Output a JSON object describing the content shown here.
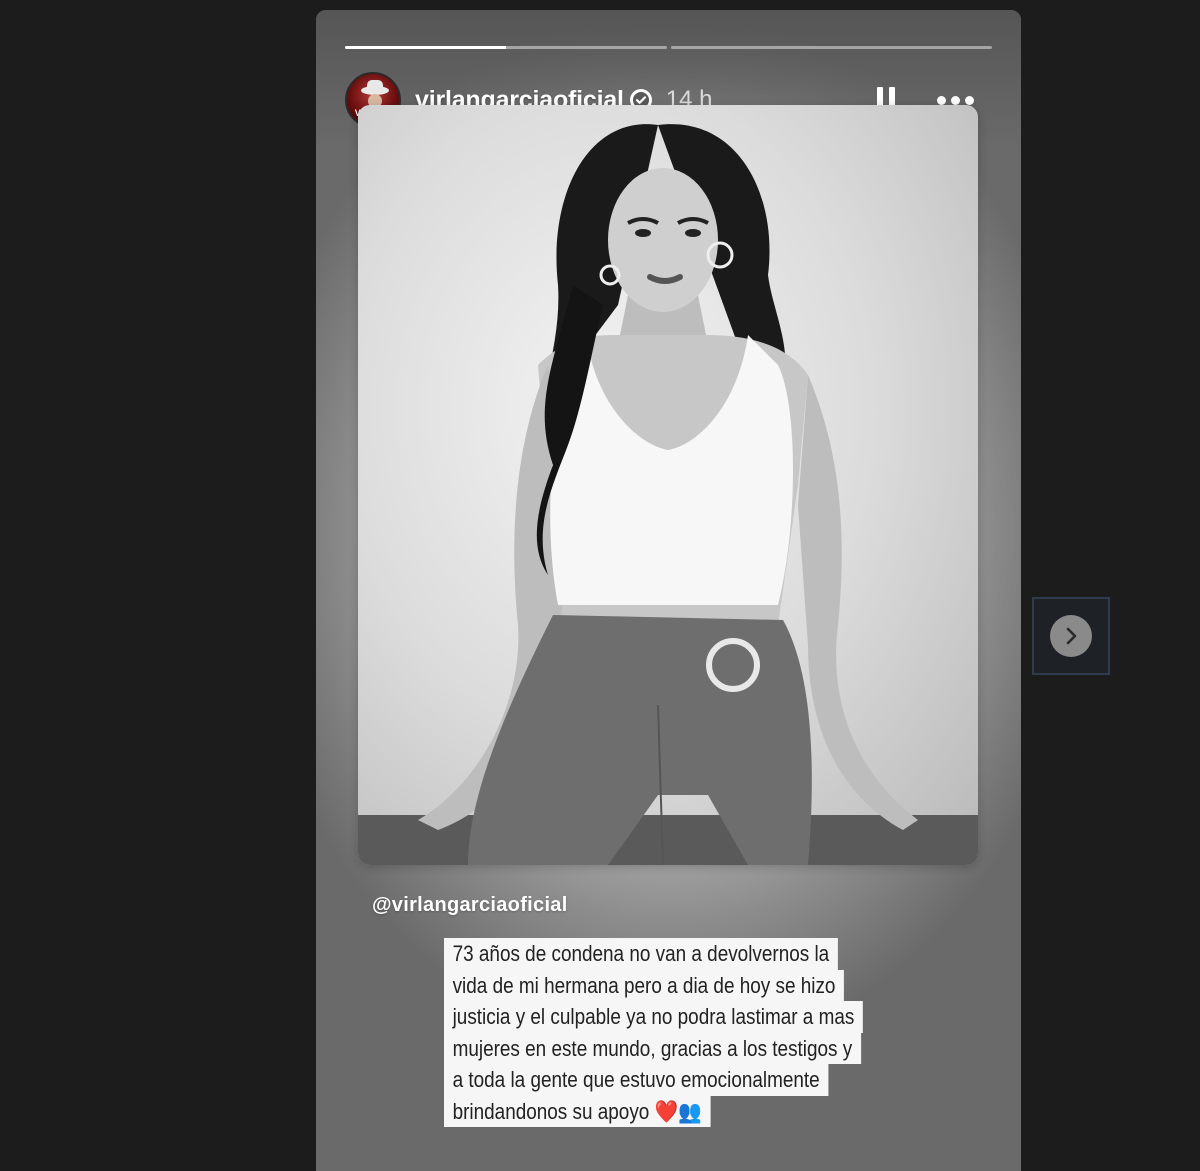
{
  "story": {
    "progress": [
      0.5,
      0.0
    ],
    "author": {
      "avatar_text": "VIRLAN",
      "username": "virlangarciaoficial",
      "verified": true,
      "time": "14 h"
    },
    "mention": "@virlangarciaoficial",
    "caption_lines": [
      "73 años de condena no van a devolvernos la",
      "vida de mi hermana pero a dia de hoy se hizo",
      "justicia y el culpable ya no podra lastimar a mas",
      "mujeres en este mundo, gracias a los testigos y",
      "a toda la gente que estuvo emocionalmente",
      "brindandonos su apoyo ❤️👥"
    ]
  },
  "controls": {
    "pause_icon": "pause-icon",
    "more_icon": "more-options-icon",
    "next_icon": "chevron-right-icon"
  }
}
